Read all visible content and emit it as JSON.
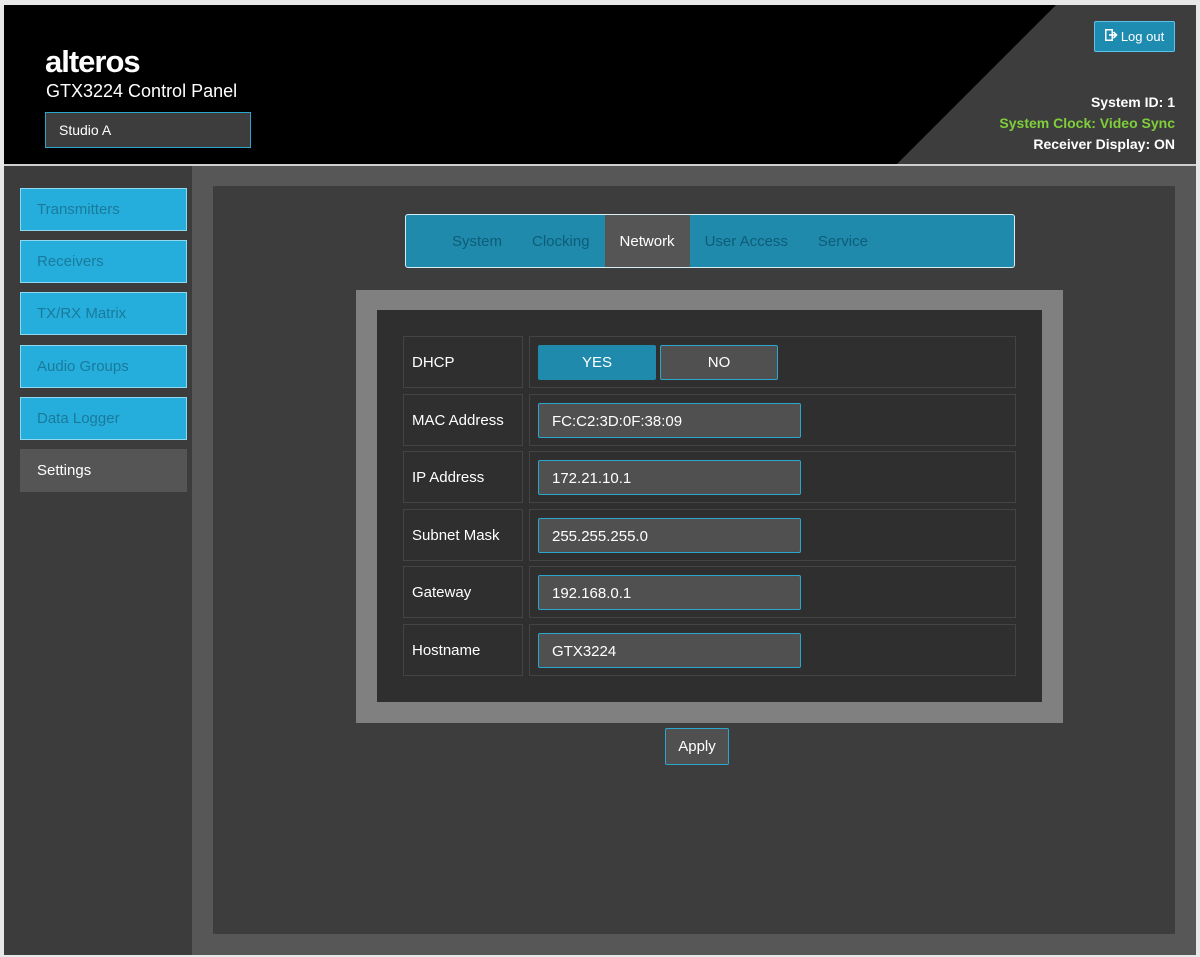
{
  "header": {
    "logo": "alteros",
    "app_title": "GTX3224 Control Panel",
    "location": "Studio A",
    "logout_label": "Log out",
    "system_id": "System ID: 1",
    "system_clock": "System Clock: Video Sync",
    "receiver_display": "Receiver Display: ON",
    "clock_color": "#7fcf3a"
  },
  "sidebar": {
    "items": [
      {
        "label": "Transmitters"
      },
      {
        "label": "Receivers"
      },
      {
        "label": "TX/RX Matrix"
      },
      {
        "label": "Audio Groups"
      },
      {
        "label": "Data Logger"
      },
      {
        "label": "Settings",
        "active": true
      }
    ]
  },
  "tabs": [
    {
      "label": "System"
    },
    {
      "label": "Clocking"
    },
    {
      "label": "Network",
      "active": true
    },
    {
      "label": "User Access"
    },
    {
      "label": "Service"
    }
  ],
  "network": {
    "dhcp": {
      "label": "DHCP",
      "yes": "YES",
      "no": "NO",
      "selected": "YES"
    },
    "mac": {
      "label": "MAC Address",
      "value": "FC:C2:3D:0F:38:09"
    },
    "ip": {
      "label": "IP Address",
      "value": "172.21.10.1"
    },
    "subnet": {
      "label": "Subnet Mask",
      "value": "255.255.255.0"
    },
    "gateway": {
      "label": "Gateway",
      "value": "192.168.0.1"
    },
    "hostname": {
      "label": "Hostname",
      "value": "GTX3224"
    }
  },
  "apply_label": "Apply",
  "accent_color": "#25aedb"
}
